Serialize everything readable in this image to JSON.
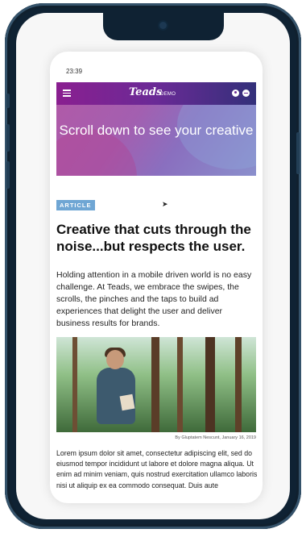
{
  "status_bar": {
    "time": "23:39"
  },
  "navbar": {
    "logo": "Teads",
    "badge": "DEMO"
  },
  "hero": {
    "text": "Scroll down to see your creative"
  },
  "article": {
    "tag": "ARTICLE",
    "title": "Creative that cuts through the noise...but respects the user.",
    "body": "Holding attention in a mobile driven world is no easy challenge. At Teads, we embrace the swipes, the scrolls, the pinches and the taps to build ad experiences that delight the user and deliver business results for brands.",
    "image_credit": "By Gluptatem Nescunt, January 16, 2019",
    "lorem": "Lorem ipsum dolor sit amet, consectetur adipiscing elit, sed do eiusmod tempor incididunt ut labore et dolore magna aliqua. Ut enim ad minim veniam, quis nostrud exercitation ullamco laboris nisi ut aliquip ex ea commodo consequat. Duis aute"
  },
  "colors": {
    "navbar_start": "#8a1f90",
    "navbar_end": "#33307a",
    "tag_bg": "#6fa6d4"
  },
  "icons": [
    "hamburger-menu-icon",
    "user-icon",
    "globe-icon",
    "camera-icon"
  ]
}
